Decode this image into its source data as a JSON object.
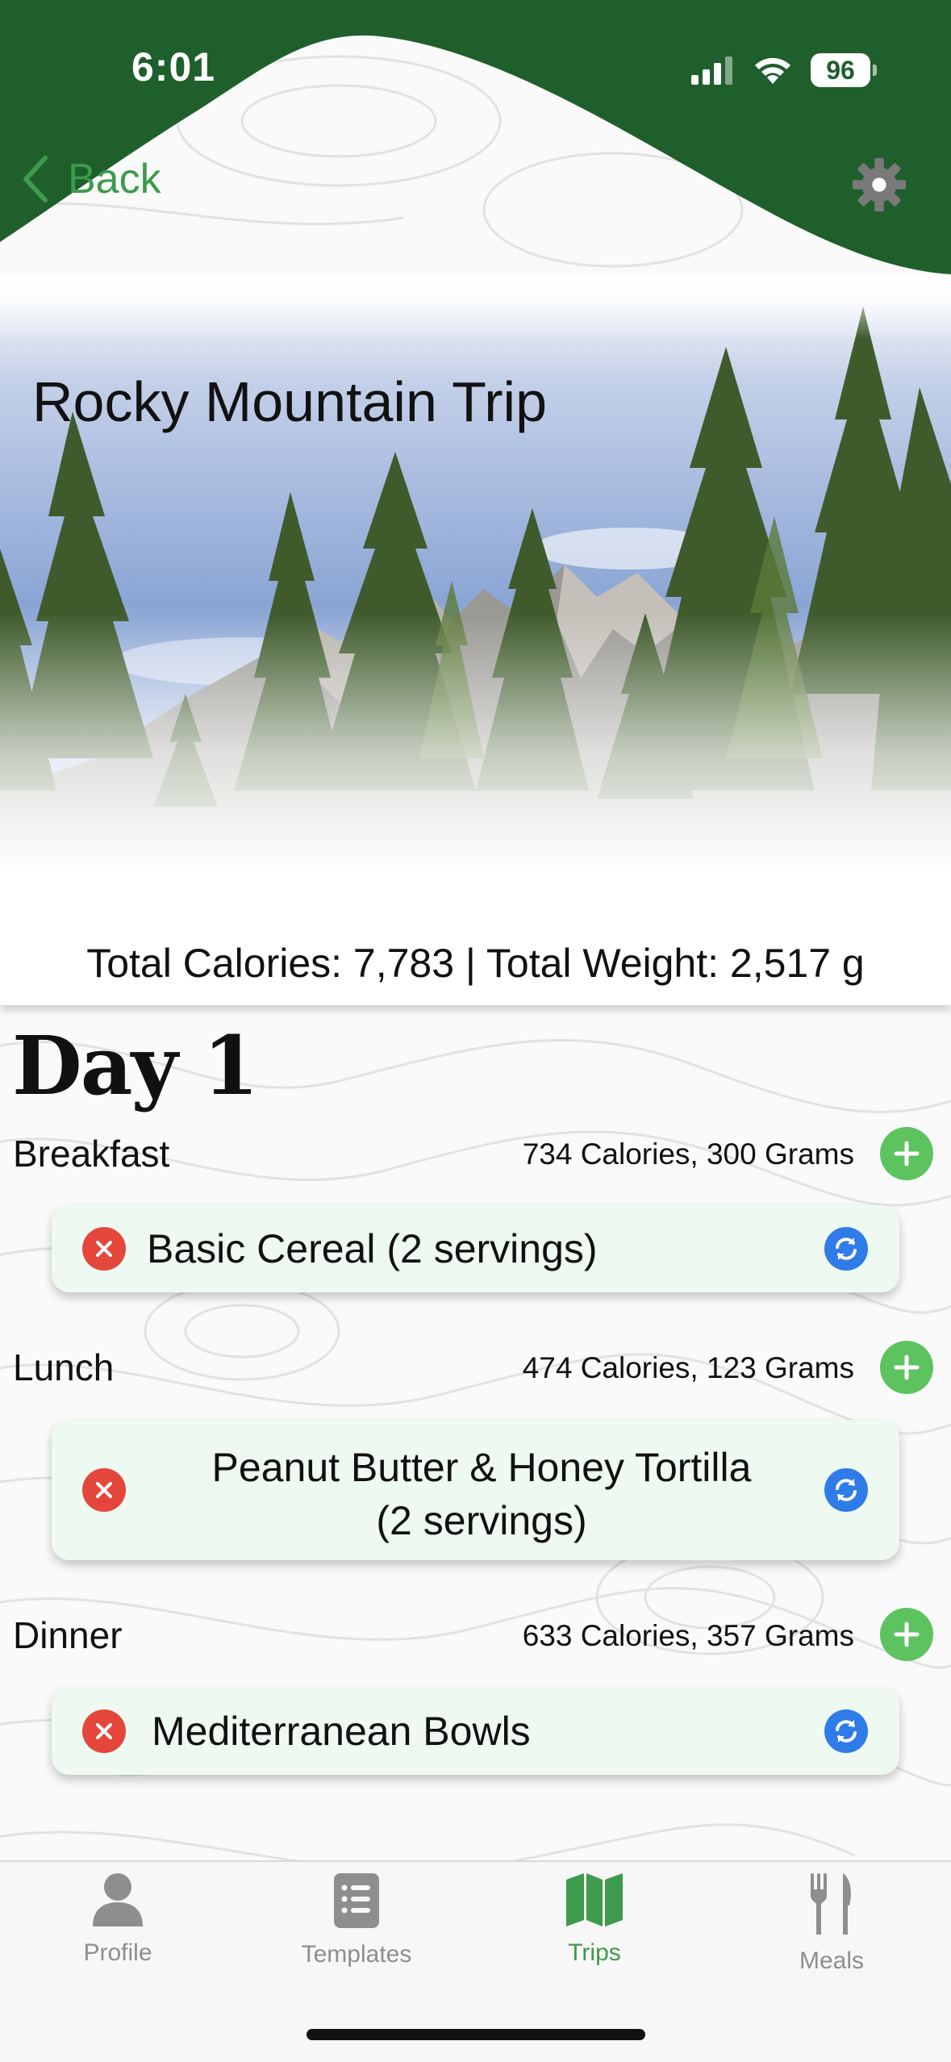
{
  "status_bar": {
    "time": "6:01",
    "battery": "96"
  },
  "nav": {
    "back_label": "Back",
    "back_icon": "chevron-left-icon",
    "settings_icon": "gear-icon"
  },
  "trip": {
    "title": "Rocky Mountain Trip",
    "totals": "Total Calories: 7,783 | Total Weight: 2,517 g"
  },
  "day": {
    "title": "Day 1",
    "meals": [
      {
        "label": "Breakfast",
        "stats": "734 Calories, 300 Grams",
        "items": [
          {
            "line1": "Basic Cereal (2 servings)",
            "line2": ""
          }
        ]
      },
      {
        "label": "Lunch",
        "stats": "474 Calories, 123 Grams",
        "items": [
          {
            "line1": "Peanut Butter & Honey Tortilla",
            "line2": "(2 servings)"
          }
        ]
      },
      {
        "label": "Dinner",
        "stats": "633 Calories, 357 Grams",
        "items": [
          {
            "line1": "Mediterranean Bowls",
            "line2": ""
          }
        ]
      }
    ]
  },
  "tabs": [
    {
      "label": "Profile",
      "icon": "person-icon",
      "active": false
    },
    {
      "label": "Templates",
      "icon": "list-icon",
      "active": false
    },
    {
      "label": "Trips",
      "icon": "map-icon",
      "active": true
    },
    {
      "label": "Meals",
      "icon": "fork-knife-icon",
      "active": false
    }
  ],
  "colors": {
    "brand_green": "#1f5f2c",
    "accent_green": "#3e9a4c",
    "add_green": "#5cc35e",
    "remove_red": "#e5463b",
    "swap_blue": "#2f7be8",
    "card_bg": "#eefaf1"
  }
}
